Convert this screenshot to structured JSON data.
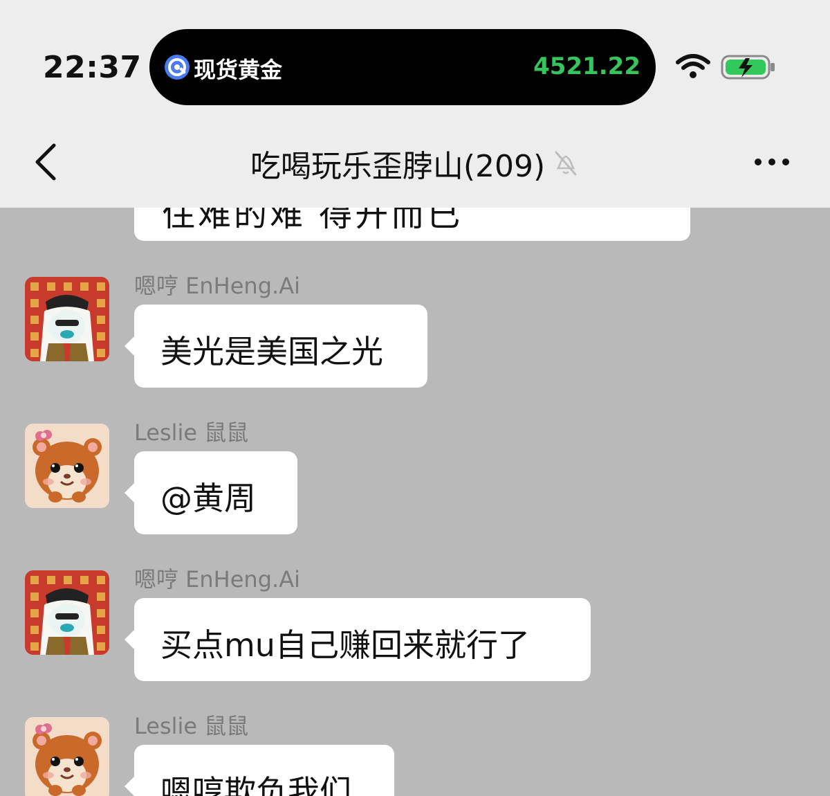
{
  "status_bar": {
    "time": "22:37",
    "island": {
      "label": "现货黄金",
      "price": "4521.22",
      "price_color": "#36c55c",
      "icon": "gold-price-icon"
    },
    "icons": [
      "wifi-icon",
      "battery-charging-icon"
    ]
  },
  "nav": {
    "title": "吃喝玩乐歪脖山(209)",
    "icons": [
      "back-chevron-icon",
      "mute-bell-icon",
      "more-icon"
    ]
  },
  "chat": {
    "partial_message": "住难的难 得开而已",
    "messages": [
      {
        "sender": "嗯哼 EnHeng.Ai",
        "text": "美光是美国之光",
        "avatar": "arab-duck-avatar"
      },
      {
        "sender": "Leslie 鼠鼠",
        "text": "@黄周",
        "avatar": "hamster-avatar"
      },
      {
        "sender": "嗯哼 EnHeng.Ai",
        "text": "买点mu自己赚回来就行了",
        "avatar": "arab-duck-avatar"
      },
      {
        "sender": "Leslie 鼠鼠",
        "text": "嗯哼欺负我们",
        "avatar": "hamster-avatar"
      }
    ]
  }
}
